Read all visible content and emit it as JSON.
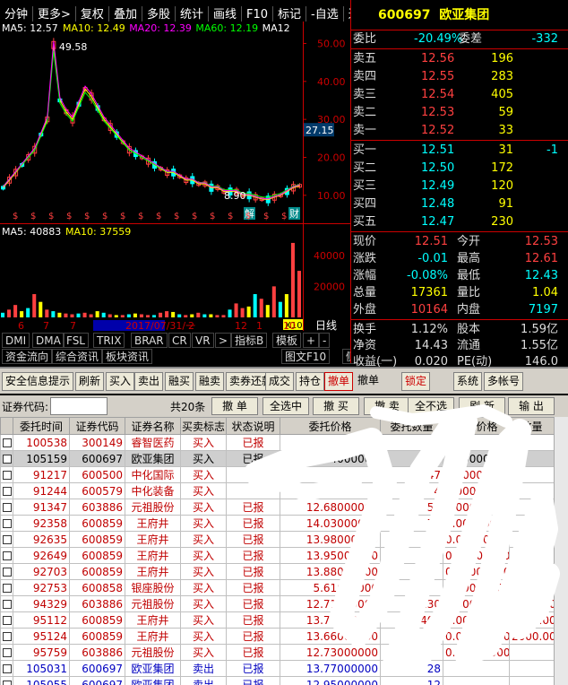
{
  "menu": [
    "分钟",
    "更多>",
    "复权",
    "叠加",
    "多股",
    "统计",
    "画线",
    "F10",
    "标记",
    "-自选",
    "返回"
  ],
  "stock": {
    "code": "600697",
    "name": "欧亚集团"
  },
  "chart": {
    "ma_legend": [
      {
        "label": "MA5: 12.57",
        "color": "#ffffff"
      },
      {
        "label": "MA10: 12.49",
        "color": "#ffff00"
      },
      {
        "label": "MA20: 12.39",
        "color": "#ff00ff"
      },
      {
        "label": "MA60: 12.19",
        "color": "#00ff00"
      },
      {
        "label": "MA12",
        "color": "#ffffff"
      }
    ],
    "price_axis": [
      "50.00",
      "40.00",
      "30.00",
      "20.00",
      "10.00"
    ],
    "current_price_tag": "27.15",
    "peak_label": "49.58",
    "low_label": "8.90",
    "jie_label": "解",
    "cai_label": "财",
    "vol_legend": [
      {
        "label": "MA5: 40883",
        "color": "#ffffff"
      },
      {
        "label": "MA10: 37559",
        "color": "#ffff00"
      }
    ],
    "vol_axis": [
      "40000",
      "20000"
    ],
    "vol_unit": "X10",
    "date_labels": [
      "6",
      "7",
      "7",
      "2017/07/31/一",
      "2",
      "12",
      "1",
      "10"
    ],
    "daily_label": "日线",
    "price_line": [
      12,
      14,
      16,
      18,
      20,
      22,
      26,
      30,
      49.58,
      35,
      32,
      30,
      34,
      38,
      36,
      33,
      30,
      28,
      26,
      24,
      22,
      21,
      20,
      19,
      18,
      17,
      16,
      16,
      15,
      14,
      14,
      13,
      13,
      12,
      12,
      11,
      11,
      11,
      10,
      10,
      9.5,
      9,
      8.9,
      9.5,
      10,
      11,
      12,
      12.5
    ],
    "volume": [
      3000,
      5000,
      8000,
      4000,
      6000,
      15000,
      10000,
      5000,
      4000,
      3000,
      2500,
      2000,
      2500,
      3000,
      2000,
      4000,
      3000,
      2000,
      1500,
      1500,
      2000,
      2500,
      2000,
      1500,
      1500,
      3000,
      4000,
      3500,
      2000,
      1500,
      2000,
      3000,
      2000,
      2000,
      1500,
      1500,
      5000,
      9000,
      6000,
      7000,
      15000,
      12000,
      8000,
      20000,
      10000,
      15000,
      48000,
      30000
    ]
  },
  "tabs_row1": [
    "DMI",
    "DMA",
    "FSL",
    "TRIX",
    "BRAR",
    "CR",
    "VR",
    ">",
    "指标B",
    "模板",
    "+",
    "-"
  ],
  "tabs_row2": [
    "资金流向",
    "综合资讯",
    "板块资讯",
    "图文F10",
    "侧边栏"
  ],
  "quote": {
    "weibi": {
      "label": "委比",
      "value": "-20.49%",
      "label2": "委差",
      "value2": "-332"
    },
    "sell": [
      {
        "label": "卖五",
        "price": "12.56",
        "vol": "196"
      },
      {
        "label": "卖四",
        "price": "12.55",
        "vol": "283"
      },
      {
        "label": "卖三",
        "price": "12.54",
        "vol": "405"
      },
      {
        "label": "卖二",
        "price": "12.53",
        "vol": "59"
      },
      {
        "label": "卖一",
        "price": "12.52",
        "vol": "33"
      }
    ],
    "buy": [
      {
        "label": "买一",
        "price": "12.51",
        "vol": "31",
        "extra": "-1"
      },
      {
        "label": "买二",
        "price": "12.50",
        "vol": "172",
        "extra": ""
      },
      {
        "label": "买三",
        "price": "12.49",
        "vol": "120",
        "extra": ""
      },
      {
        "label": "买四",
        "price": "12.48",
        "vol": "91",
        "extra": ""
      },
      {
        "label": "买五",
        "price": "12.47",
        "vol": "230",
        "extra": ""
      }
    ],
    "stats": [
      {
        "l1": "现价",
        "v1": "12.51",
        "l2": "今开",
        "v2": "12.53",
        "c1": "#ff4040",
        "c2": "#ff4040"
      },
      {
        "l1": "涨跌",
        "v1": "-0.01",
        "l2": "最高",
        "v2": "12.61",
        "c1": "#00ffff",
        "c2": "#ff4040"
      },
      {
        "l1": "涨幅",
        "v1": "-0.08%",
        "l2": "最低",
        "v2": "12.43",
        "c1": "#00ffff",
        "c2": "#00ffff"
      },
      {
        "l1": "总量",
        "v1": "17361",
        "l2": "量比",
        "v2": "1.04",
        "c1": "#ffff00",
        "c2": "#ffff00"
      },
      {
        "l1": "外盘",
        "v1": "10164",
        "l2": "内盘",
        "v2": "7197",
        "c1": "#ff4040",
        "c2": "#00ffff"
      }
    ],
    "stats2": [
      {
        "l1": "换手",
        "v1": "1.12%",
        "l2": "股本",
        "v2": "1.59亿"
      },
      {
        "l1": "净资",
        "v1": "14.43",
        "l2": "流通",
        "v2": "1.55亿"
      },
      {
        "l1": "收益(一)",
        "v1": "0.020",
        "l2": "PE(动)",
        "v2": "146.0"
      }
    ]
  },
  "toolbar": [
    "安全信息提示",
    "刷新",
    "买入",
    "卖出",
    "融买",
    "融卖",
    "卖券还款",
    "成交",
    "持仓",
    "撤单",
    "撤单",
    "锁定",
    "系统",
    "多帐号"
  ],
  "toolbar2": {
    "code_label": "证券代码:",
    "count": "共20条",
    "buttons": [
      "撤 单",
      "全选中",
      "撤 买",
      "撤 卖",
      "全不选",
      "刷 新",
      "输 出"
    ]
  },
  "columns": [
    "委托时间",
    "证券代码",
    "证券名称",
    "买卖标志",
    "状态说明",
    "委托价格",
    "委托数量",
    "成交价格",
    "数量"
  ],
  "rows": [
    {
      "time": "100538",
      "code": "300149",
      "name": "睿智医药",
      "side": "买入",
      "status": "已报",
      "price": "",
      "qty": "",
      "deal": "",
      "n": "",
      "blue": false,
      "sel": false
    },
    {
      "time": "105159",
      "code": "600697",
      "name": "欧亚集团",
      "side": "买入",
      "status": "已报",
      "price": "12.44000000",
      "qty": "731",
      "deal": "0.00000000",
      "n": "",
      "blue": false,
      "sel": true
    },
    {
      "time": "91217",
      "code": "600500",
      "name": "中化国际",
      "side": "买入",
      "status": "",
      "price": "",
      "qty": "47",
      "deal": "0.00000000",
      "n": "",
      "blue": false,
      "sel": false
    },
    {
      "time": "91244",
      "code": "600579",
      "name": "中化装备",
      "side": "买入",
      "status": "",
      "price": "",
      "qty": "4",
      "deal": "0.00000000",
      "n": "",
      "blue": false,
      "sel": false
    },
    {
      "time": "91347",
      "code": "603886",
      "name": "元祖股份",
      "side": "买入",
      "status": "已报",
      "price": "12.68000000",
      "qty": "50",
      "deal": "0.00000000",
      "n": "",
      "blue": false,
      "sel": false
    },
    {
      "time": "92358",
      "code": "600859",
      "name": "王府井",
      "side": "买入",
      "status": "已报",
      "price": "14.03000000",
      "qty": "70",
      "deal": "0.00000000",
      "n": "1000",
      "blue": false,
      "sel": false
    },
    {
      "time": "92635",
      "code": "600859",
      "name": "王府井",
      "side": "买入",
      "status": "已报",
      "price": "13.98000000",
      "qty": "",
      "deal": "0.00000000",
      "n": "",
      "blue": false,
      "sel": false
    },
    {
      "time": "92649",
      "code": "600859",
      "name": "王府井",
      "side": "买入",
      "status": "已报",
      "price": "13.95000000",
      "qty": "87",
      "deal": "0.00000000",
      "n": "",
      "blue": false,
      "sel": false
    },
    {
      "time": "92703",
      "code": "600859",
      "name": "王府井",
      "side": "买入",
      "status": "已报",
      "price": "13.88000000",
      "qty": "",
      "deal": "0.00000000",
      "n": "1000.00",
      "blue": false,
      "sel": false
    },
    {
      "time": "92753",
      "code": "600858",
      "name": "银座股份",
      "side": "买入",
      "status": "已报",
      "price": "5.61000000",
      "qty": "",
      "deal": "0.00000000",
      "n": "",
      "blue": false,
      "sel": false
    },
    {
      "time": "94329",
      "code": "603886",
      "name": "元祖股份",
      "side": "买入",
      "status": "已报",
      "price": "12.71000000",
      "qty": "130",
      "deal": "0.00000000",
      "n": "1300.00",
      "blue": false,
      "sel": false
    },
    {
      "time": "95112",
      "code": "600859",
      "name": "王府井",
      "side": "买入",
      "status": "已报",
      "price": "13.71000000",
      "qty": "402",
      "deal": "0.00000000",
      "n": "1300.00",
      "blue": false,
      "sel": false
    },
    {
      "time": "95124",
      "code": "600859",
      "name": "王府井",
      "side": "买入",
      "status": "已报",
      "price": "13.66000000",
      "qty": "405",
      "deal": "0.00000000",
      "n": "2000.00",
      "blue": false,
      "sel": false
    },
    {
      "time": "95759",
      "code": "603886",
      "name": "元祖股份",
      "side": "买入",
      "status": "已报",
      "price": "12.73000000",
      "qty": "",
      "deal": "0.00000000",
      "n": "",
      "blue": false,
      "sel": false
    },
    {
      "time": "105031",
      "code": "600697",
      "name": "欧亚集团",
      "side": "卖出",
      "status": "已报",
      "price": "13.77000000",
      "qty": "28",
      "deal": "",
      "n": "",
      "blue": true,
      "sel": false
    },
    {
      "time": "105055",
      "code": "600697",
      "name": "欧亚集团",
      "side": "卖出",
      "status": "已报",
      "price": "12.95000000",
      "qty": "12",
      "deal": "",
      "n": "",
      "blue": true,
      "sel": false
    }
  ]
}
